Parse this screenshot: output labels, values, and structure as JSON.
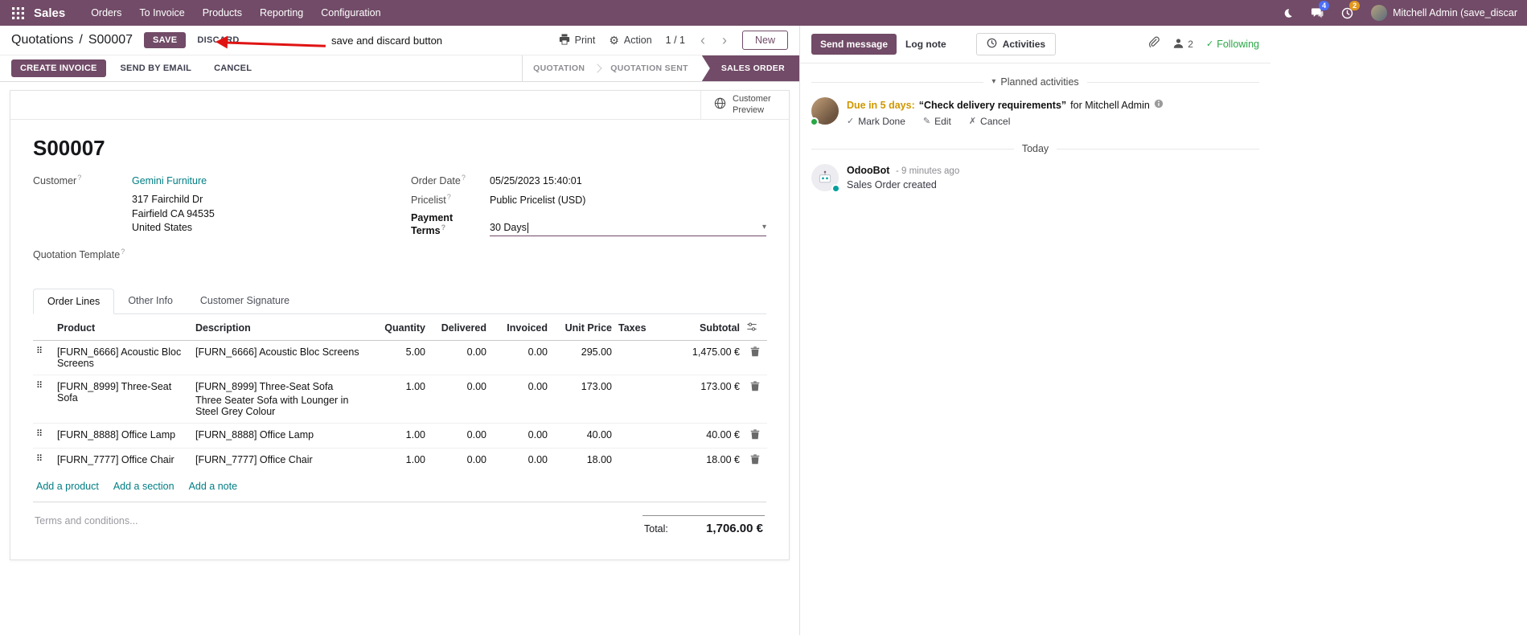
{
  "colors": {
    "brand": "#714B67",
    "link": "#017E84",
    "edited_field": "#2160b0",
    "annotation_arrow": "#e01313",
    "activity_due": "#cf9700",
    "following_green": "#28a745"
  },
  "icons": {
    "help": "?",
    "prev": "‹",
    "next": "›",
    "caret": "▾",
    "gear": "⚙",
    "check": "✓",
    "pencil": "✎",
    "cross": "✗",
    "drag": "⠿"
  },
  "topbar": {
    "app_name": "Sales",
    "menus": [
      "Orders",
      "To Invoice",
      "Products",
      "Reporting",
      "Configuration"
    ],
    "messages_badge": "4",
    "activities_badge": "2",
    "user_name": "Mitchell Admin (save_discar"
  },
  "control": {
    "breadcrumb_parent": "Quotations",
    "breadcrumb_sep": "/",
    "breadcrumb_current": "S00007",
    "save": "SAVE",
    "discard": "DISCARD",
    "print": "Print",
    "action": "Action",
    "pager": "1 / 1",
    "new": "New"
  },
  "annotation": {
    "text": "save and discard button"
  },
  "statusbar": {
    "create_invoice": "CREATE INVOICE",
    "send_by_email": "SEND BY EMAIL",
    "cancel": "CANCEL",
    "stages": [
      "QUOTATION",
      "QUOTATION SENT",
      "SALES ORDER"
    ],
    "active_stage": "SALES ORDER"
  },
  "sheet": {
    "customer_preview": "Customer Preview",
    "title": "S00007",
    "customer_label": "Customer",
    "customer_name": "Gemini Furniture",
    "address_line1": "317 Fairchild Dr",
    "address_line2": "Fairfield CA 94535",
    "address_line3": "United States",
    "quotation_template_label": "Quotation Template",
    "order_date_label": "Order Date",
    "order_date_value": "05/25/2023 15:40:01",
    "pricelist_label": "Pricelist",
    "pricelist_value": "Public Pricelist (USD)",
    "payment_terms_label": "Payment Terms",
    "payment_terms_value": "30 Days",
    "tabs": [
      "Order Lines",
      "Other Info",
      "Customer Signature"
    ]
  },
  "lines": {
    "columns": [
      "Product",
      "Description",
      "Quantity",
      "Delivered",
      "Invoiced",
      "Unit Price",
      "Taxes",
      "Subtotal"
    ],
    "rows": [
      {
        "product": "[FURN_6666] Acoustic Bloc Screens",
        "desc": "[FURN_6666] Acoustic Bloc Screens",
        "desc2": "",
        "qty": "5.00",
        "delivered": "0.00",
        "invoiced": "0.00",
        "price": "295.00",
        "taxes": "",
        "subtotal": "1,475.00 €"
      },
      {
        "product": "[FURN_8999] Three-Seat Sofa",
        "desc": "[FURN_8999] Three-Seat Sofa",
        "desc2": "Three Seater Sofa with Lounger in Steel Grey Colour",
        "qty": "1.00",
        "delivered": "0.00",
        "invoiced": "0.00",
        "price": "173.00",
        "taxes": "",
        "subtotal": "173.00 €"
      },
      {
        "product": "[FURN_8888] Office Lamp",
        "desc": "[FURN_8888] Office Lamp",
        "desc2": "",
        "qty": "1.00",
        "delivered": "0.00",
        "invoiced": "0.00",
        "price": "40.00",
        "taxes": "",
        "subtotal": "40.00 €"
      },
      {
        "product": "[FURN_7777] Office Chair",
        "desc": "[FURN_7777] Office Chair",
        "desc2": "",
        "qty": "1.00",
        "delivered": "0.00",
        "invoiced": "0.00",
        "price": "18.00",
        "taxes": "",
        "subtotal": "18.00 €"
      }
    ],
    "add_product": "Add a product",
    "add_section": "Add a section",
    "add_note": "Add a note",
    "terms_placeholder": "Terms and conditions...",
    "total_label": "Total:",
    "total_value": "1,706.00 €"
  },
  "chatter": {
    "send_message": "Send message",
    "log_note": "Log note",
    "activities": "Activities",
    "followers_count": "2",
    "following": "Following",
    "planned_header": "Planned activities",
    "activity_due": "Due in 5 days:",
    "activity_summary": "“Check delivery requirements”",
    "activity_for": "for Mitchell Admin",
    "mark_done": "Mark Done",
    "edit": "Edit",
    "cancel": "Cancel",
    "today": "Today",
    "author": "OdooBot",
    "time": "- 9 minutes ago",
    "body": "Sales Order created"
  }
}
